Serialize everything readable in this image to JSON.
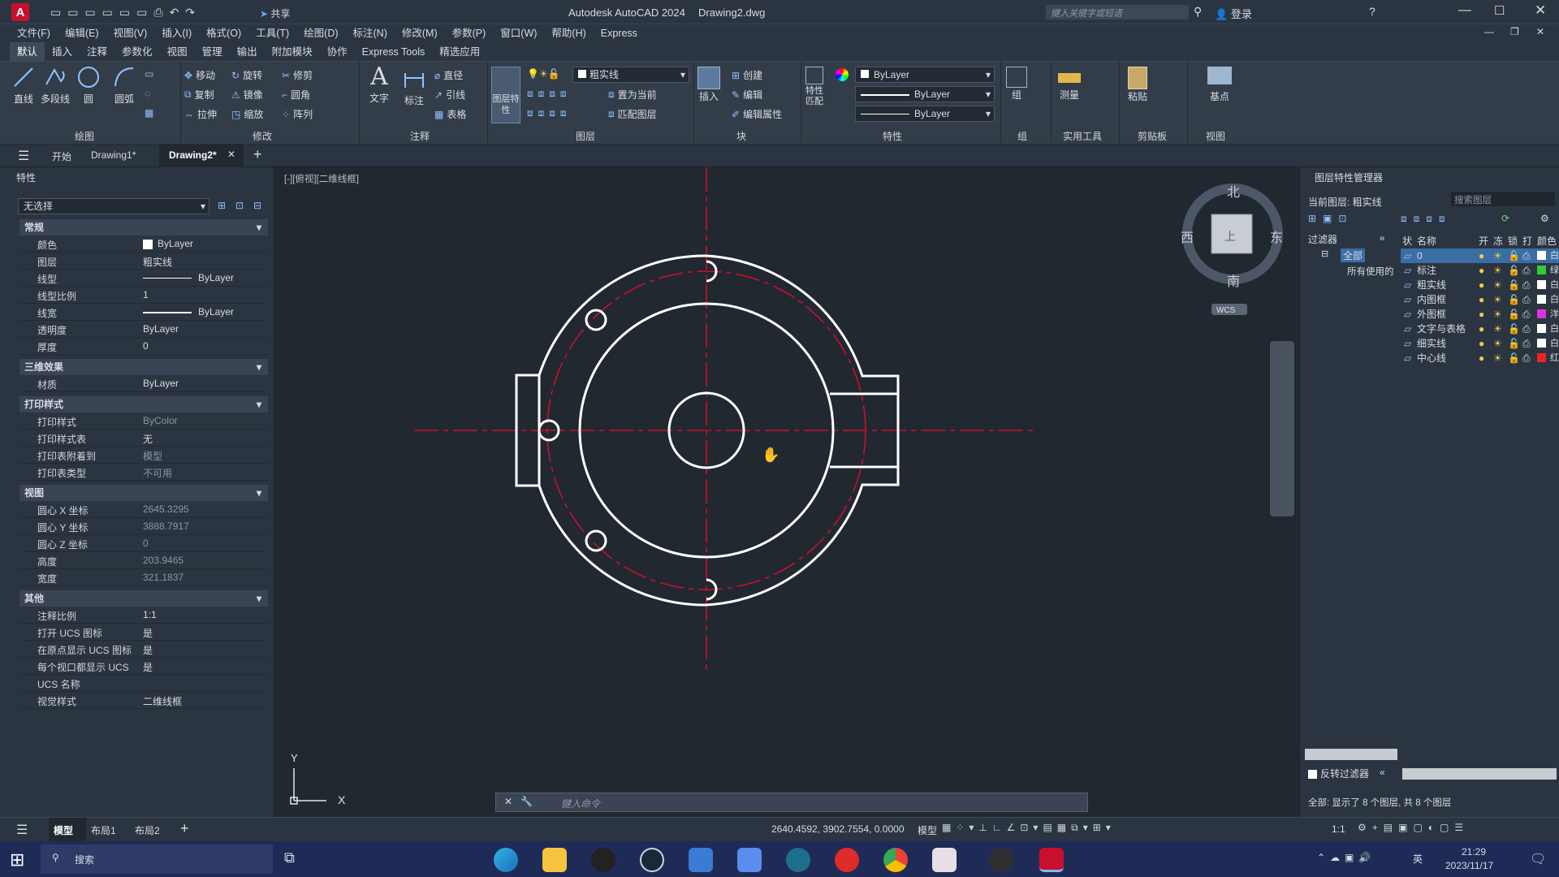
{
  "titlebar": {
    "app_title": "Autodesk AutoCAD 2024",
    "doc_title": "Drawing2.dwg",
    "share": "共享",
    "search_placeholder": "键入关键字或短语",
    "login": "登录"
  },
  "menu": [
    "文件(F)",
    "编辑(E)",
    "视图(V)",
    "插入(I)",
    "格式(O)",
    "工具(T)",
    "绘图(D)",
    "标注(N)",
    "修改(M)",
    "参数(P)",
    "窗口(W)",
    "帮助(H)",
    "Express"
  ],
  "ribbon_tabs": [
    "默认",
    "插入",
    "注释",
    "参数化",
    "视图",
    "管理",
    "输出",
    "附加模块",
    "协作",
    "Express Tools",
    "精选应用"
  ],
  "ribbon": {
    "draw": {
      "line": "直线",
      "polyline": "多段线",
      "circle": "圆",
      "arc": "圆弧",
      "group": "绘图"
    },
    "modify": {
      "move": "移动",
      "rotate": "旋转",
      "trim": "修剪",
      "copy": "复制",
      "mirror": "镜像",
      "fillet": "圆角",
      "stretch": "拉伸",
      "scale": "缩放",
      "array": "阵列",
      "group": "修改"
    },
    "annotation": {
      "text": "文字",
      "dimension": "标注",
      "linear": "直径",
      "leader": "引线",
      "table": "表格",
      "group": "注释"
    },
    "layers": {
      "props": "图层特性",
      "current_layer": "粗实线",
      "set_current": "置为当前",
      "match": "匹配图层",
      "group": "图层"
    },
    "block": {
      "insert": "插入",
      "create": "创建",
      "edit": "编辑",
      "edit_attr": "编辑属性",
      "group": "块"
    },
    "properties": {
      "match": "特性匹配",
      "color": "ByLayer",
      "linetype": "ByLayer",
      "lineweight": "ByLayer",
      "group": "特性"
    },
    "groups": {
      "group": "组",
      "group_label": "组"
    },
    "utilities": {
      "measure": "测量",
      "group": "实用工具"
    },
    "clipboard": {
      "paste": "粘贴",
      "group": "剪贴板"
    },
    "view": {
      "base": "基点",
      "group": "视图"
    }
  },
  "doc_tabs": {
    "start": "开始",
    "tab1": "Drawing1*",
    "tab2": "Drawing2*"
  },
  "props_panel": {
    "title": "特性",
    "selection": "无选择",
    "sections": {
      "general": {
        "title": "常规",
        "rows": [
          {
            "label": "颜色",
            "value": "ByLayer"
          },
          {
            "label": "图层",
            "value": "粗实线"
          },
          {
            "label": "线型",
            "value": "ByLayer"
          },
          {
            "label": "线型比例",
            "value": "1"
          },
          {
            "label": "线宽",
            "value": "ByLayer"
          },
          {
            "label": "透明度",
            "value": "ByLayer"
          },
          {
            "label": "厚度",
            "value": "0"
          }
        ]
      },
      "threed": {
        "title": "三维效果",
        "rows": [
          {
            "label": "材质",
            "value": "ByLayer"
          }
        ]
      },
      "plot": {
        "title": "打印样式",
        "rows": [
          {
            "label": "打印样式",
            "value": "ByColor"
          },
          {
            "label": "打印样式表",
            "value": "无"
          },
          {
            "label": "打印表附着到",
            "value": "模型"
          },
          {
            "label": "打印表类型",
            "value": "不可用"
          }
        ]
      },
      "view": {
        "title": "视图",
        "rows": [
          {
            "label": "圆心 X 坐标",
            "value": "2645.3295"
          },
          {
            "label": "圆心 Y 坐标",
            "value": "3888.7917"
          },
          {
            "label": "圆心 Z 坐标",
            "value": "0"
          },
          {
            "label": "高度",
            "value": "203.9465"
          },
          {
            "label": "宽度",
            "value": "321.1837"
          }
        ]
      },
      "misc": {
        "title": "其他",
        "rows": [
          {
            "label": "注释比例",
            "value": "1:1"
          },
          {
            "label": "打开 UCS 图标",
            "value": "是"
          },
          {
            "label": "在原点显示 UCS 图标",
            "value": "是"
          },
          {
            "label": "每个视口都显示 UCS",
            "value": "是"
          },
          {
            "label": "UCS 名称",
            "value": ""
          },
          {
            "label": "视觉样式",
            "value": "二维线框"
          }
        ]
      }
    }
  },
  "viewport": {
    "label": "[-][俯视][二维线框]",
    "compass": {
      "n": "北",
      "s": "南",
      "e": "东",
      "w": "西",
      "center": "上",
      "wcs": "WCS"
    },
    "ucs": {
      "x": "X",
      "y": "Y"
    },
    "command_placeholder": "键入命令"
  },
  "layer_panel": {
    "title": "图层特性管理器",
    "current": "当前图层: 粗实线",
    "search_placeholder": "搜索图层",
    "filters_label": "过滤器",
    "tree": {
      "all": "全部",
      "used": "所有使用的"
    },
    "columns": [
      "状",
      "名称",
      "开",
      "冻",
      "锁",
      "打",
      "颜色"
    ],
    "layers": [
      {
        "name": "0",
        "color": "#ffffff",
        "color_label": "白"
      },
      {
        "name": "标注",
        "color": "#33cc33",
        "color_label": "绿"
      },
      {
        "name": "粗实线",
        "color": "#ffffff",
        "color_label": "白"
      },
      {
        "name": "内图框",
        "color": "#ffffff",
        "color_label": "白"
      },
      {
        "name": "外图框",
        "color": "#dd33dd",
        "color_label": "洋"
      },
      {
        "name": "文字与表格",
        "color": "#ffffff",
        "color_label": "白"
      },
      {
        "name": "细实线",
        "color": "#ffffff",
        "color_label": "白"
      },
      {
        "name": "中心线",
        "color": "#ee2222",
        "color_label": "红"
      }
    ],
    "invert_filter": "反转过滤器",
    "footer": "全部: 显示了 8 个图层, 共 8 个图层"
  },
  "statusbar": {
    "tabs": [
      "模型",
      "布局1",
      "布局2"
    ],
    "coords": "2640.4592, 3902.7554, 0.0000",
    "mode": "模型",
    "scale": "1:1"
  },
  "taskbar": {
    "search": "搜索",
    "time": "21:29",
    "date": "2023/11/17",
    "lang": "英"
  }
}
